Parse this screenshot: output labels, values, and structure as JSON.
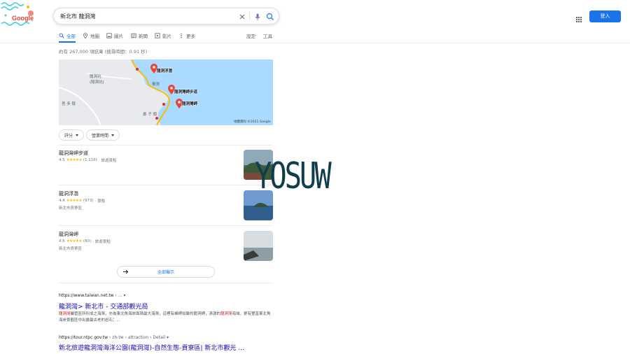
{
  "logo": {
    "text": "Google"
  },
  "search": {
    "query": "新北市 龍洞灣"
  },
  "header": {
    "signin_label": "登入"
  },
  "tabs": [
    {
      "label": "全部",
      "icon": "search-icon",
      "active": true
    },
    {
      "label": "地圖",
      "icon": "map-pin-icon"
    },
    {
      "label": "圖片",
      "icon": "image-icon"
    },
    {
      "label": "新聞",
      "icon": "news-icon"
    },
    {
      "label": "影片",
      "icon": "video-icon"
    },
    {
      "label": "更多",
      "icon": "more-icon"
    }
  ],
  "tools": {
    "settings": "設定",
    "tools": "工具"
  },
  "stats": "約有 267,000 項結果 (搜尋時間：0.91 秒)",
  "map": {
    "labels": {
      "area_top": "龍洞坑",
      "area_top2": "(陽洞坑)",
      "area_mid": "臺灣",
      "area_left": "吾 多 稜",
      "area_bottom": "鼻 子 頭"
    },
    "pins": [
      "龍洞浮潛",
      "龍洞灣岬步道",
      "龍洞灣岬"
    ],
    "copyright": "地圖資料 ©2021 Google"
  },
  "filters": [
    "評分",
    "營業時間"
  ],
  "places": [
    {
      "name": "龍洞灣岬步道",
      "rating": "4.5",
      "stars": "★★★★★",
      "reviews": "(1,116)",
      "type": "· 旅遊景點",
      "address": ""
    },
    {
      "name": "龍洞浮潛",
      "rating": "4.4",
      "stars": "★★★★★",
      "reviews": "(973)",
      "type": "· 景點",
      "address": "新北市貢寮區"
    },
    {
      "name": "龍洞灣岬",
      "rating": "4.6",
      "stars": "★★★★★",
      "reviews": "(80)",
      "type": "· 旅遊景點",
      "address": "新北市貢寮區"
    }
  ],
  "more_places": "全部顯示",
  "results": [
    {
      "url": "https://www.taiwan.net.tw",
      "crumb": "› ...",
      "title": "龍洞灣> 新北市 - 交通部觀光局",
      "snippet_parts": [
        "龍洞灣",
        "屬管區所形成之海灣，亦為東北角海岸面積最大海灣，這裡有峰岬如聚的龍洞岬，清澈的",
        "龍洞灣",
        "海域，更有豐富東北角海岸景觀區中出露最古老的岩石；..."
      ]
    },
    {
      "url": "https://tour.ntpc.gov.tw",
      "crumb": "› zh-tw › attraction › Detail",
      "title": "新北旅遊龍洞灣海洋公園(龍洞灣)-自然生態-貢寮區| 新北市觀光 ..."
    }
  ],
  "watermark": "YOSUW",
  "colors": {
    "accent": "#1a73e8",
    "link": "#1a0dab",
    "water": "#aadaff",
    "land": "#e8eaed",
    "star": "#fbbc04"
  }
}
